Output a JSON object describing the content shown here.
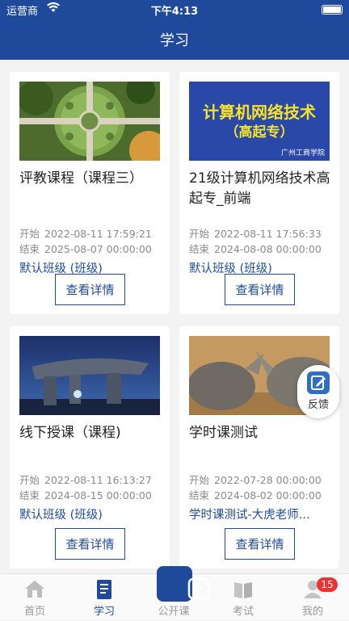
{
  "status": {
    "carrier": "运营商",
    "time": "下午4:13"
  },
  "header": {
    "title": "学习"
  },
  "labels": {
    "start": "开始",
    "end": "结束",
    "button": "查看详情"
  },
  "courses": [
    {
      "title": "评教课程（课程三）",
      "start": "2022-08-11 17:59:21",
      "end": "2025-08-07 00:00:00",
      "class": "默认班级 (班级)",
      "image": "garden-aerial"
    },
    {
      "title": "21级计算机网络技术高起专_前端",
      "start": "2022-08-11 17:56:33",
      "end": "2024-08-08 00:00:00",
      "class": "默认班级 (班级)",
      "image": "course-banner",
      "banner_line1": "计算机网络技术",
      "banner_line2": "（高起专）",
      "banner_logo": "广州工商学院"
    },
    {
      "title": "线下授课（课程)",
      "start": "2022-08-11 16:13:27",
      "end": "2024-08-15 00:00:00",
      "class": "默认班级 (班级)",
      "image": "dolmen-night"
    },
    {
      "title": "学时课测试",
      "start": "2022-07-28 00:00:00",
      "end": "2024-08-02 00:00:00",
      "class": "学时课测试-大虎老师...",
      "image": "rhinos"
    }
  ],
  "feedback": {
    "label": "反馈"
  },
  "tabs": [
    {
      "label": "首页",
      "icon": "home-icon"
    },
    {
      "label": "学习",
      "icon": "book-icon",
      "active": true
    },
    {
      "label": "公开课",
      "icon": "play-icon"
    },
    {
      "label": "考试",
      "icon": "exam-icon"
    },
    {
      "label": "我的",
      "icon": "user-icon",
      "badge": "15"
    }
  ],
  "colors": {
    "primary": "#1f4a9c",
    "badge": "#ee3333"
  }
}
